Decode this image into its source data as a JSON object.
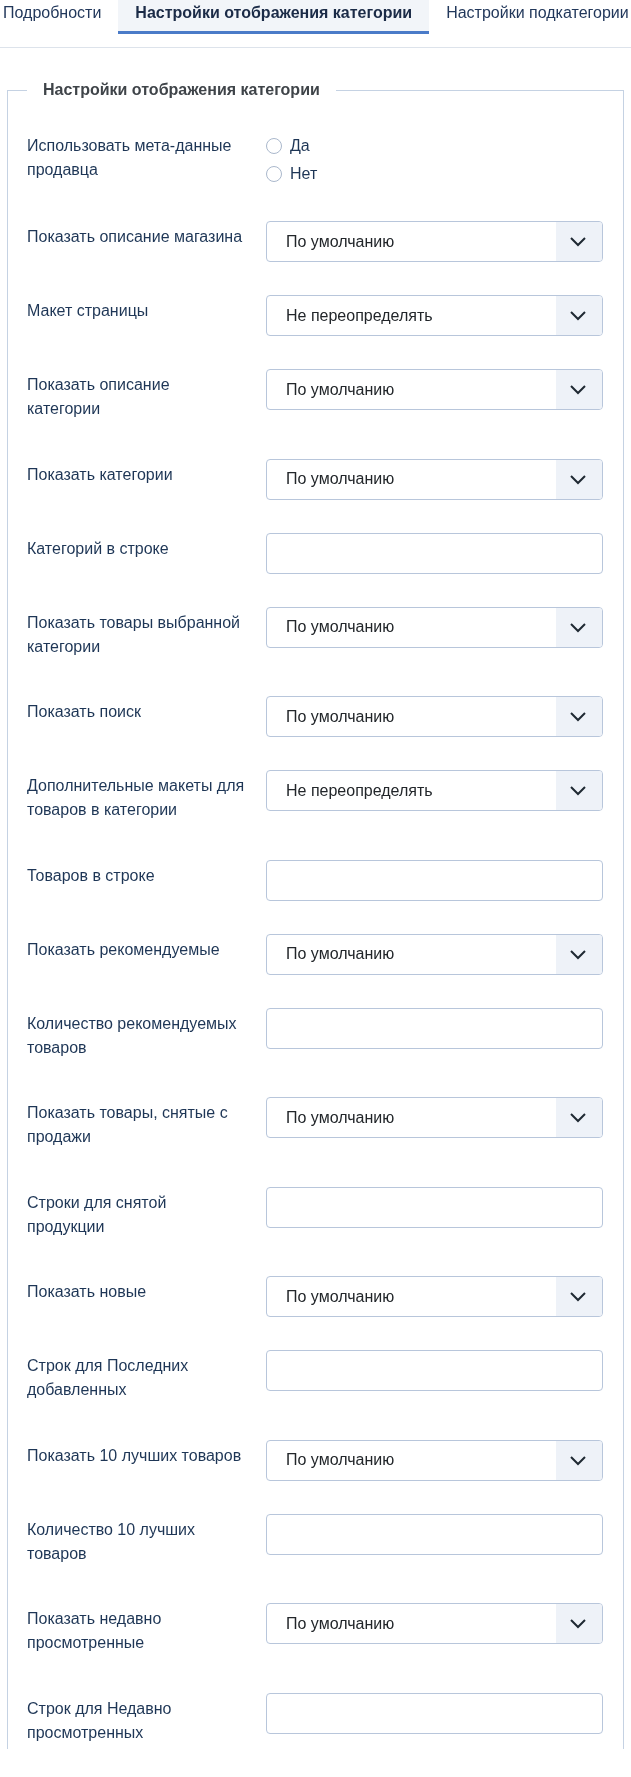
{
  "tabs": [
    {
      "label": "Подробности",
      "selected": false
    },
    {
      "label": "Настройки отображения категории",
      "selected": true
    },
    {
      "label": "Настройки подкатегории",
      "selected": false
    }
  ],
  "fieldset": {
    "legend": "Настройки отображения категории",
    "fields": [
      {
        "kind": "radio",
        "label": "Использовать мета-данные продавца",
        "options": [
          {
            "label": "Да",
            "selected": false
          },
          {
            "label": "Нет",
            "selected": false
          }
        ]
      },
      {
        "kind": "select",
        "label": "Показать описание магазина",
        "value": "По умолчанию"
      },
      {
        "kind": "select",
        "label": "Макет страницы",
        "value": "Не переопределять"
      },
      {
        "kind": "select",
        "label": "Показать описание категории",
        "value": "По умолчанию"
      },
      {
        "kind": "select",
        "label": "Показать категории",
        "value": "По умолчанию"
      },
      {
        "kind": "text",
        "label": "Категорий в строке"
      },
      {
        "kind": "select",
        "label": "Показать товары выбранной категории",
        "value": "По умолчанию"
      },
      {
        "kind": "select",
        "label": "Показать поиск",
        "value": "По умолчанию"
      },
      {
        "kind": "select",
        "label": "Дополнительные макеты для товаров в категории",
        "value": "Не переопределять"
      },
      {
        "kind": "text",
        "label": "Товаров в строке"
      },
      {
        "kind": "select",
        "label": "Показать рекомендуемые",
        "value": "По умолчанию"
      },
      {
        "kind": "text",
        "label": "Количество рекомендуемых товаров"
      },
      {
        "kind": "select",
        "label": "Показать товары, снятые с продажи",
        "value": "По умолчанию"
      },
      {
        "kind": "text",
        "label": "Строки для снятой продукции"
      },
      {
        "kind": "select",
        "label": "Показать новые",
        "value": "По умолчанию"
      },
      {
        "kind": "text",
        "label": "Строк для Последних добавленных"
      },
      {
        "kind": "select",
        "label": "Показать 10 лучших товаров",
        "value": "По умолчанию"
      },
      {
        "kind": "text",
        "label": "Количество 10 лучших товаров"
      },
      {
        "kind": "select",
        "label": "Показать недавно просмотренные",
        "value": "По умолчанию"
      },
      {
        "kind": "text",
        "label": "Строк для Недавно просмотренных"
      }
    ]
  }
}
